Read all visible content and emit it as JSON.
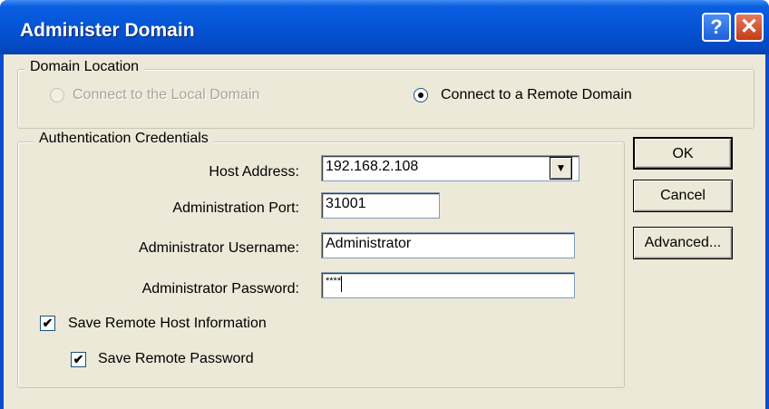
{
  "window": {
    "title": "Administer Domain",
    "help_glyph": "?",
    "close_glyph": "✕"
  },
  "domain_location": {
    "legend": "Domain Location",
    "local_label": "Connect to the Local Domain",
    "remote_label": "Connect to a Remote Domain",
    "selected": "remote"
  },
  "credentials": {
    "legend": "Authentication Credentials",
    "host_label": "Host Address:",
    "host_value": "192.168.2.108",
    "port_label": "Administration Port:",
    "port_value": "31001",
    "username_label": "Administrator Username:",
    "username_value": "Administrator",
    "password_label": "Administrator Password:",
    "password_value": "****",
    "save_host_label": "Save Remote Host Information",
    "save_host_checked": true,
    "save_password_label": "Save Remote Password",
    "save_password_checked": true
  },
  "buttons": {
    "ok": "OK",
    "cancel": "Cancel",
    "advanced": "Advanced..."
  },
  "icons": {
    "dropdown_arrow": "▼",
    "checkmark": "✔"
  }
}
